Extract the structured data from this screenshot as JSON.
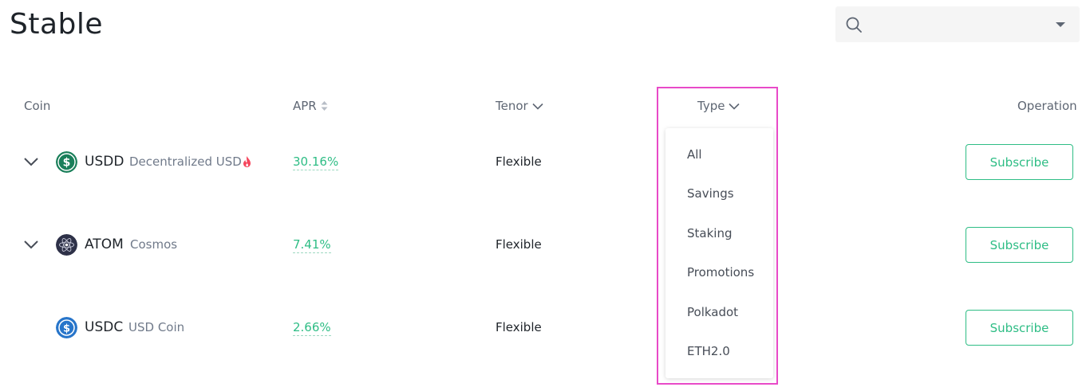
{
  "page": {
    "title": "Stable"
  },
  "search": {
    "placeholder": ""
  },
  "table": {
    "headers": {
      "coin": "Coin",
      "apr": "APR",
      "tenor": "Tenor",
      "type": "Type",
      "operation": "Operation"
    },
    "rows": [
      {
        "symbol": "USDD",
        "name": "Decentralized USD",
        "apr": "30.16%",
        "tenor": "Flexible",
        "action": "Subscribe",
        "expandable": true,
        "hot": true,
        "icon": "usdd-coin-icon"
      },
      {
        "symbol": "ATOM",
        "name": "Cosmos",
        "apr": "7.41%",
        "tenor": "Flexible",
        "action": "Subscribe",
        "expandable": true,
        "hot": false,
        "icon": "atom-coin-icon"
      },
      {
        "symbol": "USDC",
        "name": "USD Coin",
        "apr": "2.66%",
        "tenor": "Flexible",
        "action": "Subscribe",
        "expandable": false,
        "hot": false,
        "icon": "usdc-coin-icon"
      }
    ]
  },
  "type_dropdown": {
    "options": [
      "All",
      "Savings",
      "Staking",
      "Promotions",
      "Polkadot",
      "ETH2.0"
    ]
  },
  "colors": {
    "accent": "#2ebd85",
    "highlight": "#e84ac8",
    "muted": "#707a8a",
    "text": "#1e2329"
  }
}
